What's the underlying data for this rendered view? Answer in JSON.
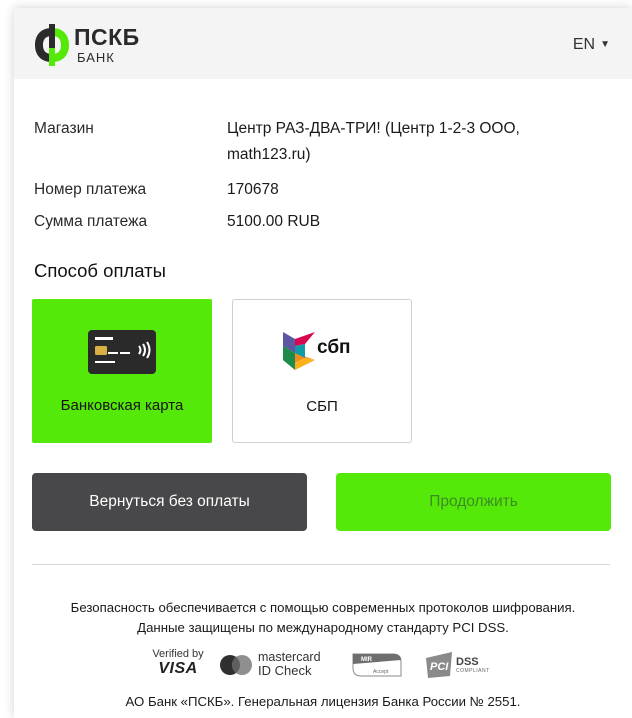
{
  "header": {
    "logo_name": "ПСКБ",
    "logo_sub": "БАНК",
    "language": "EN"
  },
  "payment_info": [
    {
      "label": "Магазин",
      "value": "Центр РАЗ-ДВА-ТРИ! (Центр 1-2-3 ООО, math123.ru)"
    },
    {
      "label": "Номер платежа",
      "value": "170678"
    },
    {
      "label": "Сумма платежа",
      "value": "5100.00 RUB"
    }
  ],
  "payment_method": {
    "title": "Способ оплаты",
    "options": [
      {
        "label": "Банковская карта",
        "icon": "bank-card-icon",
        "selected": true
      },
      {
        "label": "СБП",
        "icon": "sbp-logo-icon",
        "logo_text": "сбп",
        "selected": false
      }
    ]
  },
  "actions": {
    "back_label": "Вернуться без оплаты",
    "continue_label": "Продолжить"
  },
  "footer": {
    "security_line1": "Безопасность обеспечивается с помощью современных протоколов шифрования.",
    "security_line2": "Данные защищены по международному стандарту PCI DSS.",
    "badges": {
      "visa_top": "Verified by",
      "visa_main": "VISA",
      "mc_top": "mastercard",
      "mc_bottom": "ID Check",
      "mir_top": "MIR",
      "mir_bottom": "Accept",
      "pci_main": "DSS",
      "pci_sub": "COMPLIANT"
    },
    "license": "АО Банк «ПСКБ». Генеральная лицензия Банка России № 2551."
  },
  "colors": {
    "accent_green": "#54e909",
    "dark_button": "#48484b",
    "header_bg": "#f4f4f4"
  }
}
